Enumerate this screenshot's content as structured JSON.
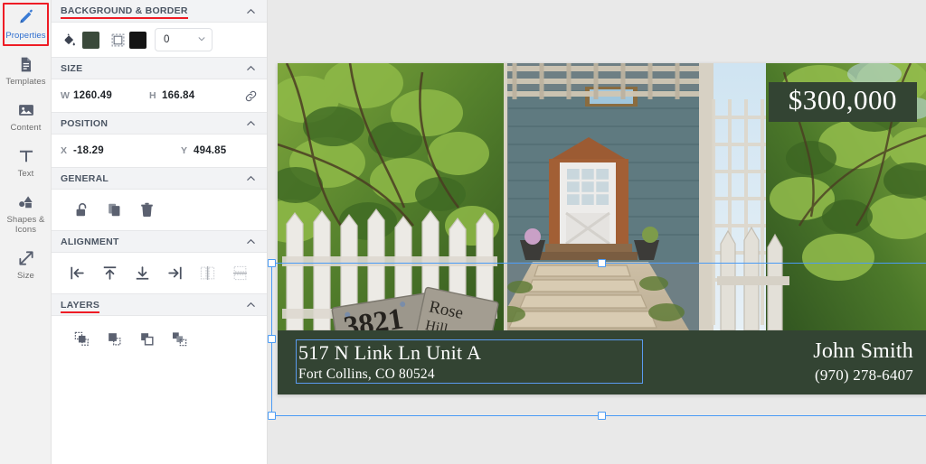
{
  "rail": {
    "items": [
      {
        "label": "Properties",
        "icon": "pencil-icon",
        "active": true
      },
      {
        "label": "Templates",
        "icon": "document-icon",
        "active": false
      },
      {
        "label": "Content",
        "icon": "image-icon",
        "active": false
      },
      {
        "label": "Text",
        "icon": "text-t-icon",
        "active": false
      },
      {
        "label": "Shapes & Icons",
        "icon": "shapes-icon",
        "active": false
      },
      {
        "label": "Size",
        "icon": "resize-arrows-icon",
        "active": false
      }
    ]
  },
  "panel": {
    "sections": [
      {
        "title": "BACKGROUND & BORDER",
        "highlighted": true
      },
      {
        "title": "SIZE",
        "highlighted": false
      },
      {
        "title": "POSITION",
        "highlighted": false
      },
      {
        "title": "GENERAL",
        "highlighted": false
      },
      {
        "title": "ALIGNMENT",
        "highlighted": false
      },
      {
        "title": "LAYERS",
        "highlighted": true
      }
    ],
    "background": {
      "fill_icon": "paint-bucket-icon",
      "fill_color": "#3b4a3b",
      "border_icon": "border-box-icon",
      "border_color": "#141414",
      "border_width_value": "0",
      "border_width_caret": "chevron-down-icon"
    },
    "size": {
      "width_label": "W",
      "width_value": "1260.49",
      "height_label": "H",
      "height_value": "166.84",
      "link_icon": "link-chain-icon"
    },
    "position": {
      "x_label": "X",
      "x_value": "-18.29",
      "y_label": "Y",
      "y_value": "494.85"
    },
    "general": {
      "buttons": [
        "unlock-icon",
        "duplicate-icon",
        "trash-icon"
      ]
    },
    "alignment": {
      "buttons": [
        "align-left-icon",
        "align-top-icon",
        "align-bottom-icon",
        "align-right-icon",
        "align-center-horizontal-icon",
        "align-center-vertical-icon"
      ]
    },
    "layers": {
      "buttons": [
        "bring-to-front-icon",
        "bring-forward-icon",
        "send-backward-icon",
        "send-to-back-icon"
      ]
    }
  },
  "canvas": {
    "price": "$300,000",
    "address_line1": "517 N Link Ln Unit A",
    "address_line2": "Fort Collins, CO 80524",
    "agent_name": "John Smith",
    "agent_phone": "(970) 278-6407",
    "house_sign_number": "3821",
    "accent_green": "#334433",
    "selection_blue": "#4a9bf5"
  }
}
